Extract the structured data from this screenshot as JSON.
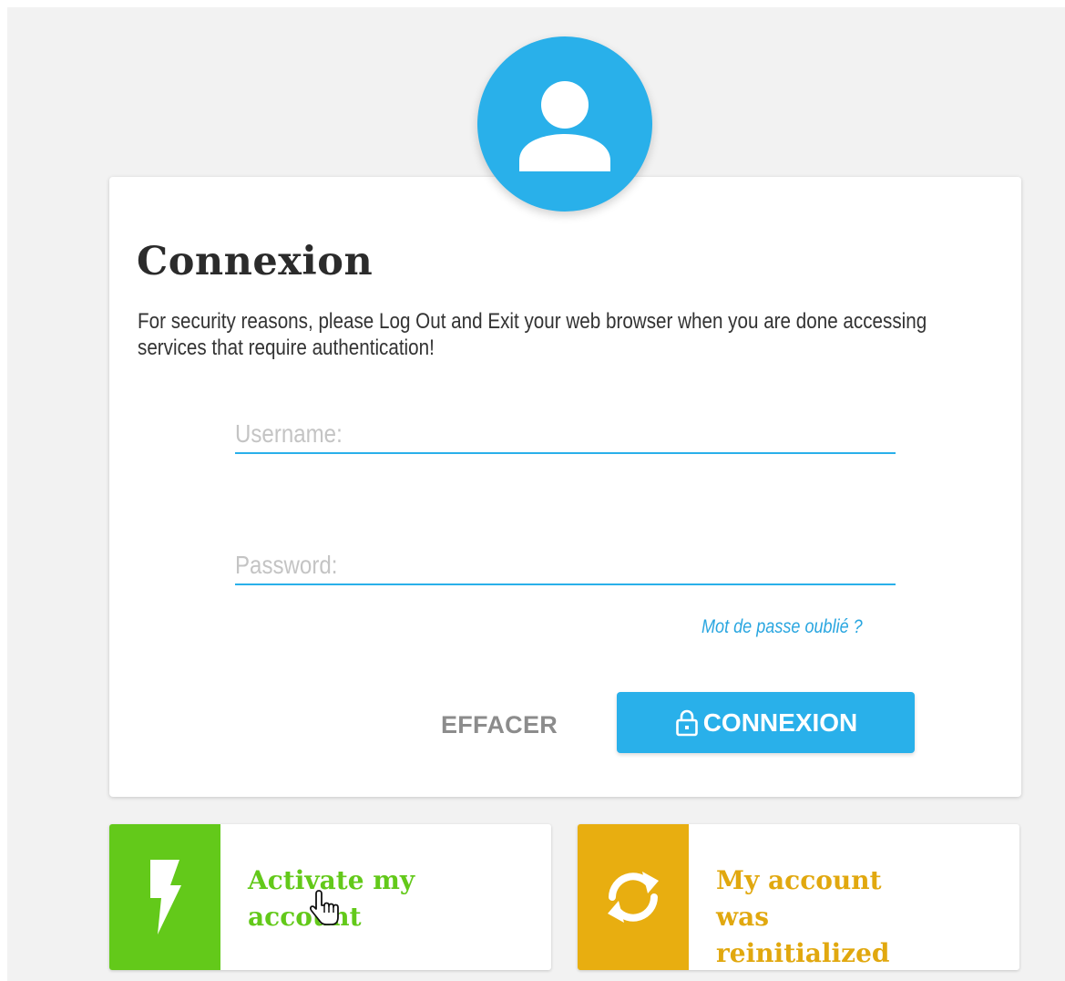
{
  "colors": {
    "accent": "#29b0ea",
    "activate_tile": "#63c91a",
    "reset_tile": "#e8ae10",
    "clear_text": "#8c8c8c"
  },
  "avatar": {
    "icon": "user-icon"
  },
  "login": {
    "title": "Connexion",
    "notice": "For security reasons, please Log Out and Exit your web browser when you are done accessing services that require authentication!",
    "username": {
      "placeholder": "Username:",
      "value": ""
    },
    "password": {
      "placeholder": "Password:",
      "value": ""
    },
    "forgot_link": "Mot de passe oublié ?",
    "clear_button": "EFFACER",
    "submit_button": "CONNEXION",
    "submit_icon": "lock-icon"
  },
  "tiles": [
    {
      "label": "Activate my account",
      "icon": "lightning-bolt-icon"
    },
    {
      "label": "My account was reinitialized",
      "icon": "refresh-icon"
    }
  ],
  "cursor": {
    "icon": "hand-pointer-icon"
  }
}
